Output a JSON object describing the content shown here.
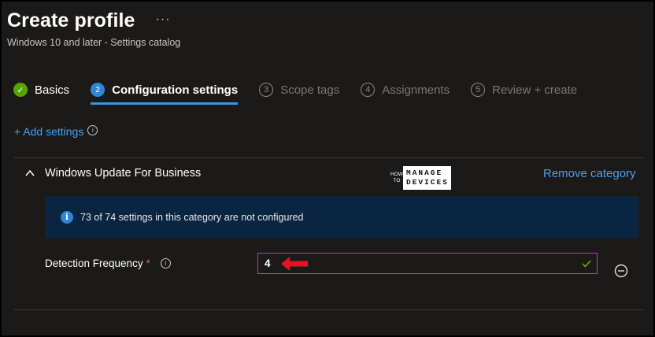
{
  "header": {
    "title": "Create profile",
    "more_label": "···",
    "subtitle": "Windows 10 and later - Settings catalog"
  },
  "steps": [
    {
      "badge": "✓",
      "label": "Basics",
      "state": "done"
    },
    {
      "badge": "2",
      "label": "Configuration settings",
      "state": "active"
    },
    {
      "badge": "3",
      "label": "Scope tags",
      "state": "inactive"
    },
    {
      "badge": "4",
      "label": "Assignments",
      "state": "inactive"
    },
    {
      "badge": "5",
      "label": "Review + create",
      "state": "inactive"
    }
  ],
  "add_settings": {
    "label": "+ Add settings",
    "info_glyph": "i"
  },
  "category": {
    "title": "Windows Update For Business",
    "remove_label": "Remove category",
    "banner_icon_glyph": "i",
    "banner_text": "73 of 74 settings in this category are not configured"
  },
  "watermark": {
    "box_line1": "HOW",
    "box_line2": "TO",
    "line1": "MANAGE",
    "line2": "DEVICES"
  },
  "setting": {
    "label": "Detection Frequency",
    "required_mark": "*",
    "info_glyph": "i",
    "value": "4"
  },
  "colors": {
    "accent": "#3a96dd",
    "link": "#4aa0f0",
    "success": "#57a300",
    "input_border": "#c239b3",
    "annotation_arrow": "#e81123",
    "banner_bg": "#0a2541"
  },
  "icons": {
    "collapse": "chevron-up-icon",
    "check": "checkmark-icon",
    "remove": "minus-circle-icon",
    "info": "info-icon"
  }
}
